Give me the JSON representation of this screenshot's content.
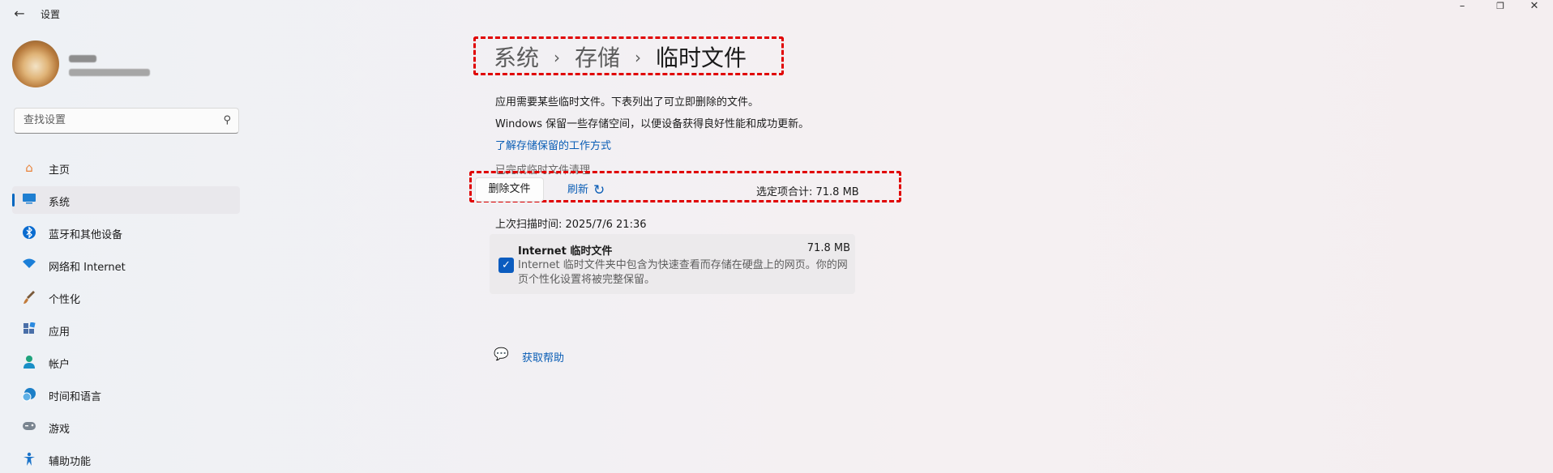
{
  "window": {
    "title": "设置",
    "back_icon": "back-arrow-icon",
    "controls": [
      "minimize-icon",
      "maximize-icon",
      "close-icon"
    ]
  },
  "search": {
    "placeholder": "查找设置",
    "icon": "search-icon"
  },
  "sidebar": {
    "items": [
      {
        "label": "主页",
        "icon": "home-icon",
        "color": "#e8833a",
        "active": false
      },
      {
        "label": "系统",
        "icon": "system-monitor-icon",
        "color": "#1f7fd1",
        "active": true
      },
      {
        "label": "蓝牙和其他设备",
        "icon": "bluetooth-icon",
        "color": "#0a6cd0",
        "active": false
      },
      {
        "label": "网络和 Internet",
        "icon": "wifi-icon",
        "color": "#1b7fd8",
        "active": false
      },
      {
        "label": "个性化",
        "icon": "brush-icon",
        "color": "#c27b3a",
        "active": false
      },
      {
        "label": "应用",
        "icon": "apps-icon",
        "color": "#4a6fa8",
        "active": false
      },
      {
        "label": "帐户",
        "icon": "account-icon",
        "color": "#1fa37c",
        "active": false
      },
      {
        "label": "时间和语言",
        "icon": "time-language-icon",
        "color": "#1c7fc7",
        "active": false
      },
      {
        "label": "游戏",
        "icon": "gamepad-icon",
        "color": "#7a8590",
        "active": false
      },
      {
        "label": "辅助功能",
        "icon": "accessibility-icon",
        "color": "#1a73c9",
        "active": false
      }
    ]
  },
  "breadcrumb": {
    "items": [
      "系统",
      "存储",
      "临时文件"
    ]
  },
  "main": {
    "desc1": "应用需要某些临时文件。下表列出了可立即删除的文件。",
    "desc2": "Windows 保留一些存储空间，以便设备获得良好性能和成功更新。",
    "learn_link": "了解存储保留的工作方式",
    "cleanup_status": "已完成临时文件清理",
    "delete_button": "删除文件",
    "refresh_button": "刷新",
    "selected_total": "选定项合计: 71.8 MB",
    "last_scan": "上次扫描时间: 2025/7/6 21:36",
    "items": [
      {
        "title": "Internet 临时文件",
        "size": "71.8 MB",
        "checked": true,
        "description": "Internet 临时文件夹中包含为快速查看而存储在硬盘上的网页。你的网页个性化设置将被完整保留。"
      }
    ],
    "help_link": "获取帮助"
  },
  "colors": {
    "accent": "#0067c0",
    "link": "#0a5db5",
    "highlight_border": "#e00000"
  }
}
